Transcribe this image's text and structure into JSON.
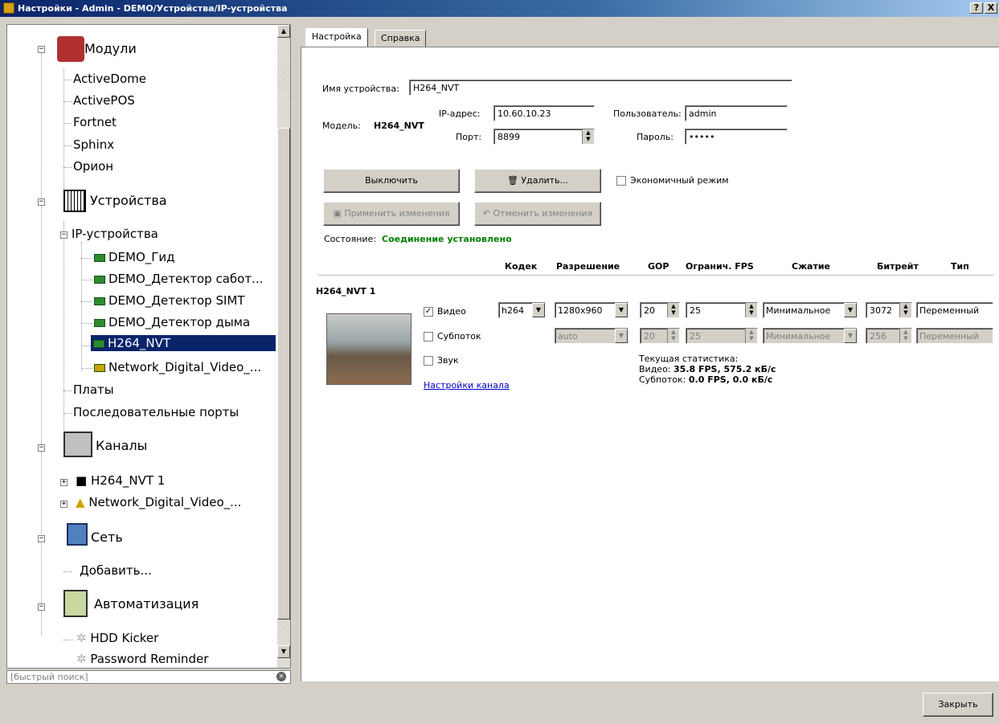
{
  "window": {
    "title": "Настройки - Admin - DEMO/Устройства/IP-устройства",
    "help": "?",
    "close": "X"
  },
  "tree": {
    "modules": "Модули",
    "activedome": "ActiveDome",
    "activepos": "ActivePOS",
    "fortnet": "Fortnet",
    "sphinx": "Sphinx",
    "orion": "Орион",
    "devices": "Устройства",
    "ip_devices": "IP-устройства",
    "demo_gid": "DEMO_Гид",
    "demo_sabot": "DEMO_Детектор сабот...",
    "demo_simt": "DEMO_Детектор SIMT",
    "demo_smoke": "DEMO_Детектор дыма",
    "h264": "H264_NVT",
    "ndv": "Network_Digital_Video_...",
    "boards": "Платы",
    "serial": "Последовательные порты",
    "channels": "Каналы",
    "ch_h264": "H264_NVT 1",
    "ch_ndv": "Network_Digital_Video_...",
    "network": "Сеть",
    "add": "Добавить...",
    "automation": "Автоматизация",
    "hdd": "HDD Kicker",
    "password": "Password Reminder"
  },
  "search": {
    "placeholder": "[быстрый поиск]"
  },
  "tabs": [
    "Настройка",
    "Справка"
  ],
  "device": {
    "name_label": "Имя устройства:",
    "name_value": "H264_NVT",
    "model_label": "Модель:",
    "model_value": "H264_NVT",
    "ip_label": "IP-адрес:",
    "ip_value": "10.60.10.23",
    "port_label": "Порт:",
    "port_value": "8899",
    "user_label": "Пользователь:",
    "user_value": "admin",
    "pass_label": "Пароль:",
    "pass_value": "•••••"
  },
  "buttons": {
    "disable": "Выключить",
    "delete": "Удалить...",
    "eco": "Экономичный режим",
    "apply": "Применить изменения",
    "cancel": "Отменить изменения",
    "close": "Закрыть"
  },
  "status": {
    "label": "Состояние:",
    "value": "Соединение установлено"
  },
  "table": {
    "headers": [
      "Кодек",
      "Разрешение",
      "GOP",
      "Огранич. FPS",
      "Сжатие",
      "Битрейт",
      "Тип"
    ],
    "channel": "H264_NVT 1",
    "video": {
      "label": "Видео",
      "codec": "h264",
      "res": "1280x960",
      "gop": "20",
      "fps": "25",
      "comp": "Минимальное",
      "bitrate": "3072",
      "type": "Переменный"
    },
    "sub": {
      "label": "Субпоток",
      "codec": "auto",
      "gop": "20",
      "fps": "25",
      "comp": "Минимальное",
      "bitrate": "256",
      "type": "Переменный"
    },
    "sound": "Звук",
    "channel_settings": "Настройки канала",
    "stats_title": "Текущая статистика:",
    "stats_video_label": "Видео:",
    "stats_video_value": "35.8 FPS, 575.2 кБ/с",
    "stats_sub_label": "Субпоток:",
    "stats_sub_value": "0.0 FPS, 0.0 кБ/с"
  },
  "colors": {
    "title": "#0a246a",
    "selection": "#0a246a",
    "status": "#008000",
    "link": "#0000cc"
  }
}
